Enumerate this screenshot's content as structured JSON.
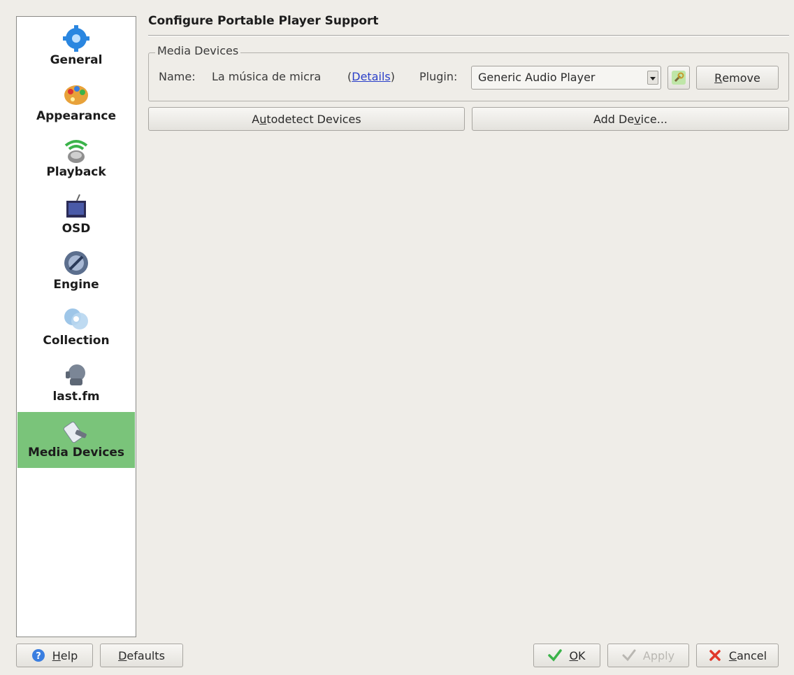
{
  "sidebar": {
    "items": [
      {
        "label": "General",
        "icon": "gear-icon"
      },
      {
        "label": "Appearance",
        "icon": "palette-icon"
      },
      {
        "label": "Playback",
        "icon": "speaker-icon"
      },
      {
        "label": "OSD",
        "icon": "tv-icon"
      },
      {
        "label": "Engine",
        "icon": "engine-icon"
      },
      {
        "label": "Collection",
        "icon": "collection-icon"
      },
      {
        "label": "last.fm",
        "icon": "lastfm-icon"
      },
      {
        "label": "Media Devices",
        "icon": "media-device-icon",
        "active": true
      }
    ]
  },
  "main": {
    "title": "Configure Portable Player Support",
    "group_title": "Media Devices",
    "name_label": "Name:",
    "name_value": "La música de micra",
    "details_open": "(",
    "details_link": "Details",
    "details_close": ")",
    "plugin_label": "Plugin:",
    "plugin_value": "Generic Audio Player",
    "remove_pre": "",
    "remove_ul": "R",
    "remove_post": "emove",
    "autodetect_pre": "A",
    "autodetect_ul": "u",
    "autodetect_post": "todetect Devices",
    "add_pre": "Add De",
    "add_ul": "v",
    "add_post": "ice..."
  },
  "footer": {
    "help_ul": "H",
    "help_post": "elp",
    "defaults_ul": "D",
    "defaults_post": "efaults",
    "ok_ul": "O",
    "ok_post": "K",
    "apply_label": "Apply",
    "cancel_ul": "C",
    "cancel_post": "ancel"
  },
  "colors": {
    "active_item": "#7ac47a",
    "link": "#2a3fc9",
    "background": "#efede8"
  }
}
